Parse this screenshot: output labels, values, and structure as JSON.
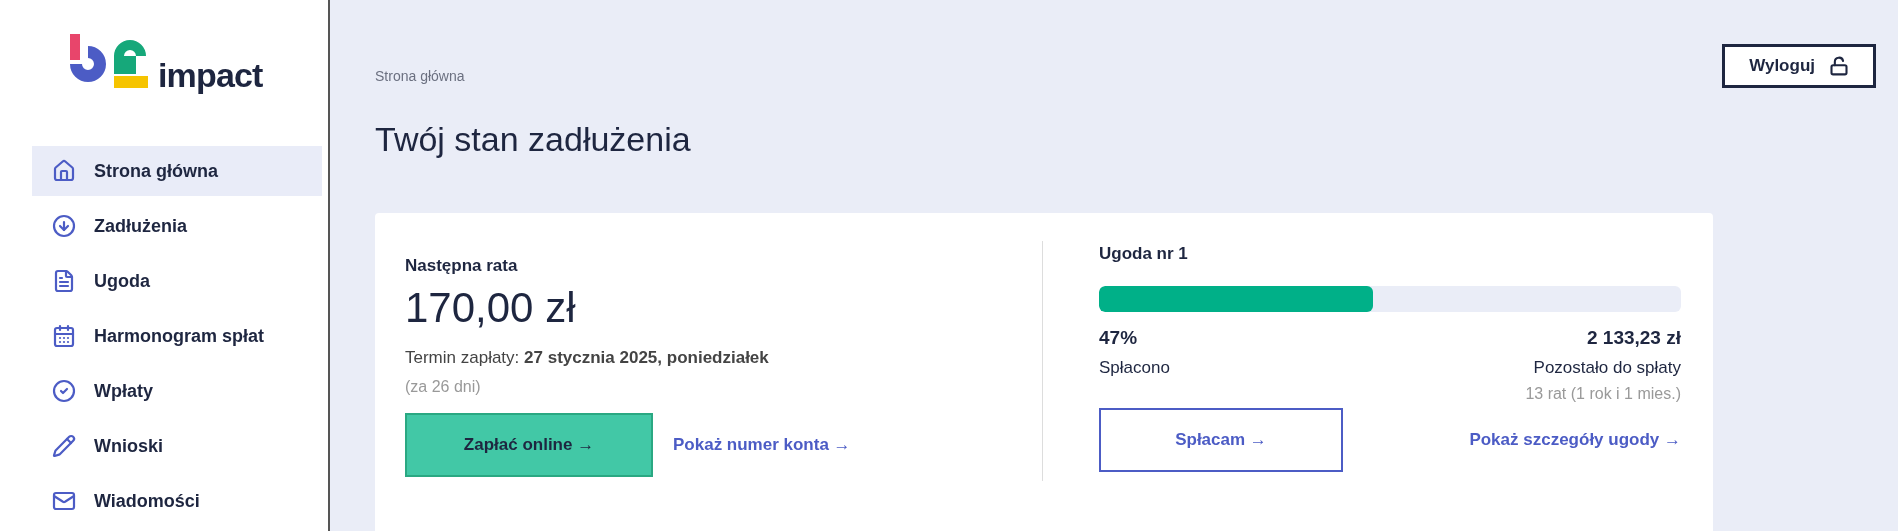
{
  "logo": {
    "text": "impact"
  },
  "sidebar": {
    "items": [
      {
        "label": "Strona główna",
        "selected": true
      },
      {
        "label": "Zadłużenia",
        "selected": false
      },
      {
        "label": "Ugoda",
        "selected": false
      },
      {
        "label": "Harmonogram spłat",
        "selected": false
      },
      {
        "label": "Wpłaty",
        "selected": false
      },
      {
        "label": "Wnioski",
        "selected": false
      },
      {
        "label": "Wiadomości",
        "selected": false
      }
    ]
  },
  "breadcrumb": "Strona główna",
  "logout_button": "Wyloguj",
  "title": "Twój stan zadłużenia",
  "next_installment": {
    "heading": "Następna rata",
    "amount": "170,00 zł",
    "due": "Termin zapłaty: **27 stycznia 2025, poniedziałek**",
    "days_left": "(za 26 dni)",
    "pay_button": "Zapłać online →",
    "account_link": "Pokaż numer konta →"
  },
  "agreement": {
    "heading": "Ugoda nr 1",
    "progress": {
      "level": 0.47
    },
    "paid_percent": "47%",
    "paid_label": "Spłacono",
    "remaining_amount": "2 133,23 zł",
    "remaining_label": "Pozostało do spłaty",
    "remaining_installments": "13 rat (1 rok i 1 mies.)",
    "repay_button": "Spłacam →",
    "details_link": "Pokaż szczegóły ugody →"
  }
}
